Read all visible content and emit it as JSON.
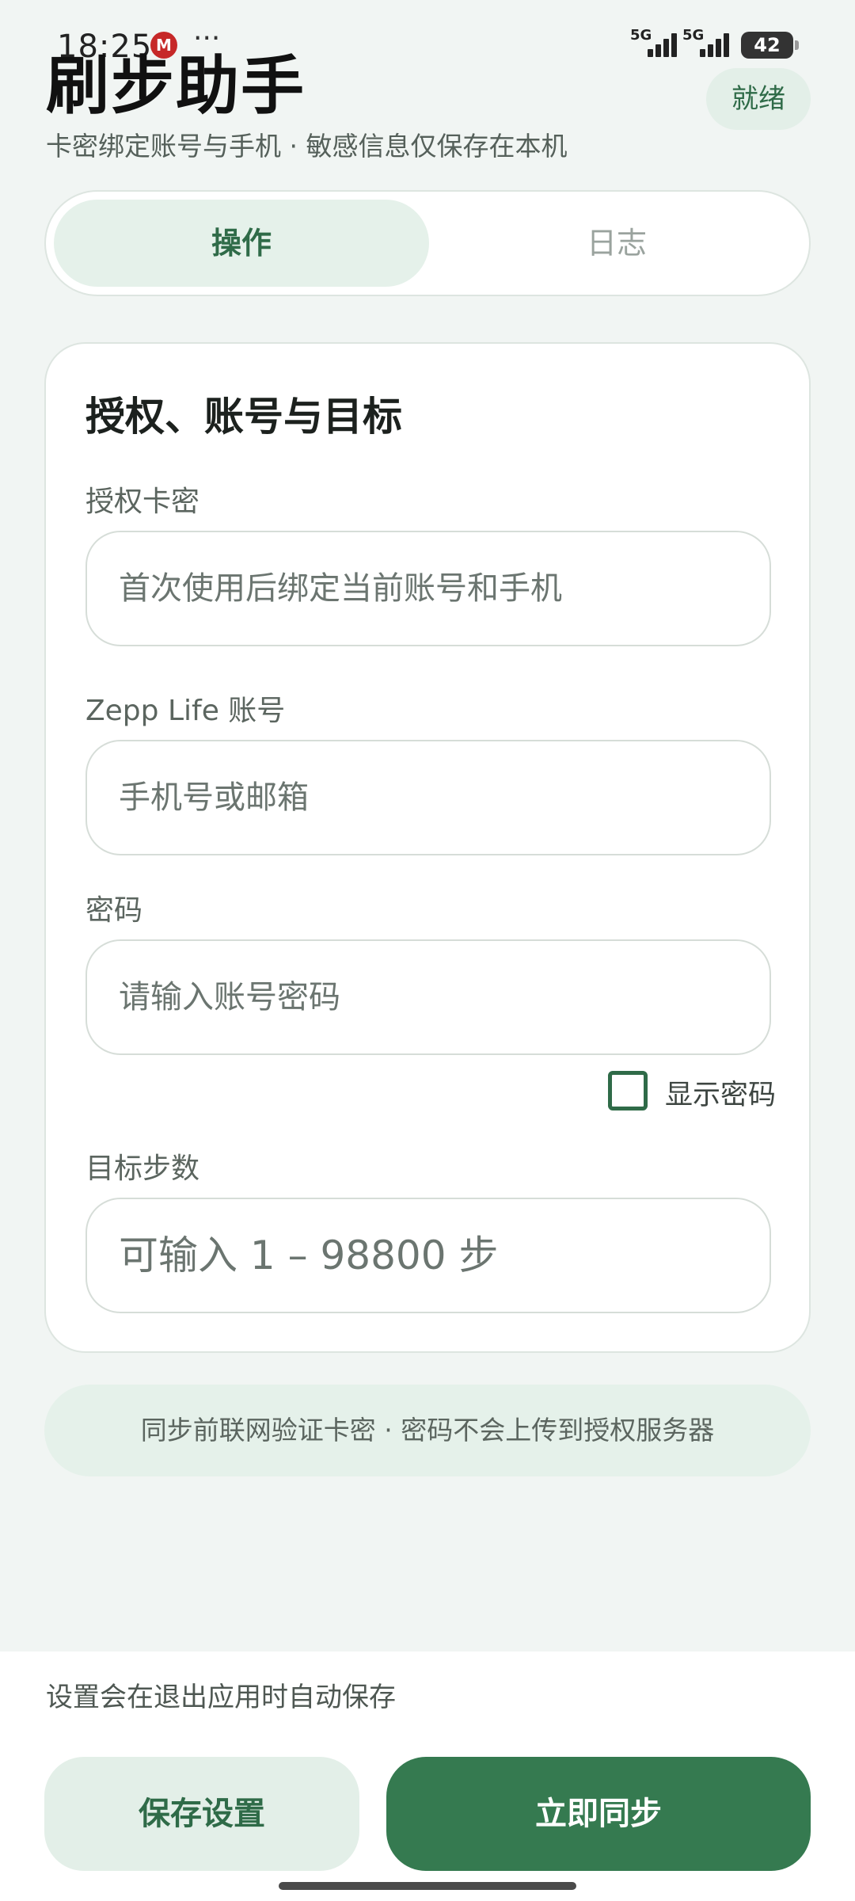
{
  "status_bar": {
    "time": "18:25",
    "carrier_icon": "china-merchants-bank-icon",
    "more": "···",
    "signal_1_label": "5G",
    "signal_2_label": "5G",
    "battery": "42"
  },
  "header": {
    "title": "刷步助手",
    "subtitle": "卡密绑定账号与手机 · 敏感信息仅保存在本机",
    "status": "就绪"
  },
  "tabs": [
    {
      "label": "操作",
      "active": true
    },
    {
      "label": "日志",
      "active": false
    }
  ],
  "card": {
    "title": "授权、账号与目标",
    "fields": {
      "license": {
        "label": "授权卡密",
        "placeholder": "首次使用后绑定当前账号和手机",
        "value": ""
      },
      "account": {
        "label": "Zepp Life 账号",
        "placeholder": "手机号或邮箱",
        "value": ""
      },
      "password": {
        "label": "密码",
        "placeholder": "请输入账号密码",
        "value": ""
      },
      "steps": {
        "label": "目标步数",
        "placeholder": "可输入 1 – 98800 步",
        "value": ""
      }
    },
    "show_password": {
      "label": "显示密码",
      "checked": false
    }
  },
  "hint": "同步前联网验证卡密 · 密码不会上传到授权服务器",
  "bottom": {
    "autosave_note": "设置会在退出应用时自动保存",
    "save_button": "保存设置",
    "sync_button": "立即同步"
  },
  "colors": {
    "accent": "#357a50",
    "accent_light": "#e3efe8",
    "background": "#f1f5f3"
  }
}
